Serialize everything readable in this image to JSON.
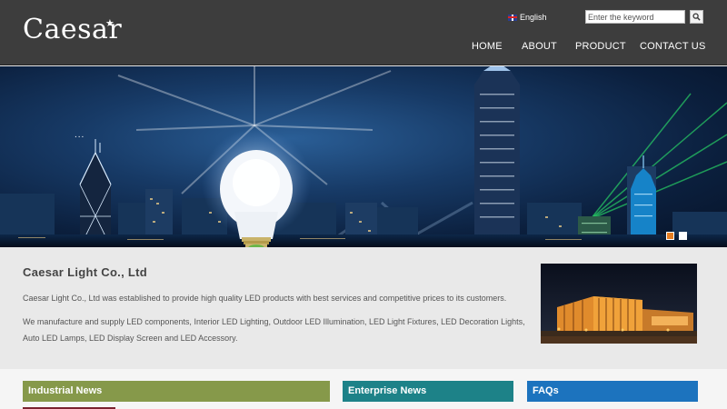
{
  "header": {
    "logo_text": "Caesar",
    "logo_star": "★",
    "language": "English",
    "search": {
      "placeholder": "Enter the keyword"
    },
    "nav": [
      "HOME",
      "ABOUT",
      "PRODUCT",
      "CONTACT US"
    ]
  },
  "banner": {
    "more_indicator": "...",
    "slides": 2,
    "active_slide": 1
  },
  "intro": {
    "title": "Caesar Light Co., Ltd",
    "paragraphs": [
      "Caesar Light Co., Ltd was established to provide high quality LED products with best services and competitive prices to its customers.",
      "We manufacture and supply LED components, Interior LED Lighting, Outdoor LED Illumination, LED Light Fixtures, LED Decoration Lights, Auto LED Lamps, LED Display Screen and LED Accessory."
    ]
  },
  "tabs": [
    "Industrial News",
    "Enterprise News",
    "FAQs"
  ],
  "colors": {
    "header_bg": "#3d3d3d",
    "industrial": "#86994a",
    "enterprise": "#1d8288",
    "faqs": "#1c73be",
    "active_dot": "#e67e22"
  }
}
